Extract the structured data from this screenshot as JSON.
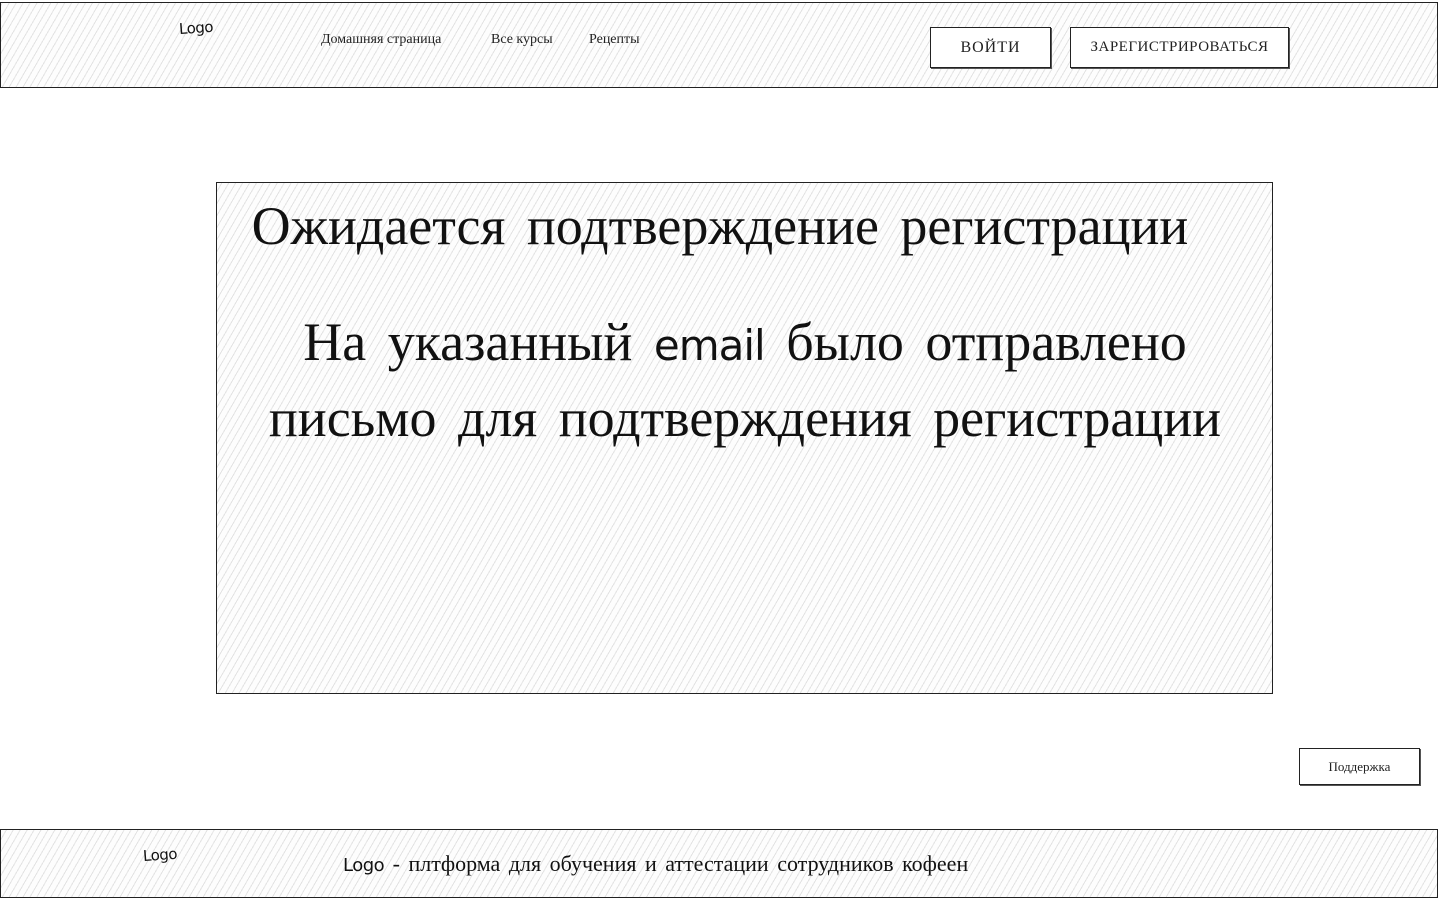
{
  "header": {
    "logo": "Logo",
    "nav": [
      "Домашняя страница",
      "Все курсы",
      "Рецепты"
    ],
    "login_label": "ВОЙТИ",
    "register_label": "ЗАРЕГИСТРИРОВАТЬСЯ"
  },
  "main": {
    "title": "Ожидается подтверждение регистрации",
    "message_before": "На указанный ",
    "message_email": "email",
    "message_after": " было отправлено письмо для подтверждения регистрации"
  },
  "support": {
    "label": "Поддержка"
  },
  "footer": {
    "logo": "Logo",
    "text_logo": "Logo",
    "text": " - плтформа для обучения и аттестации сотрудников кофеен"
  }
}
